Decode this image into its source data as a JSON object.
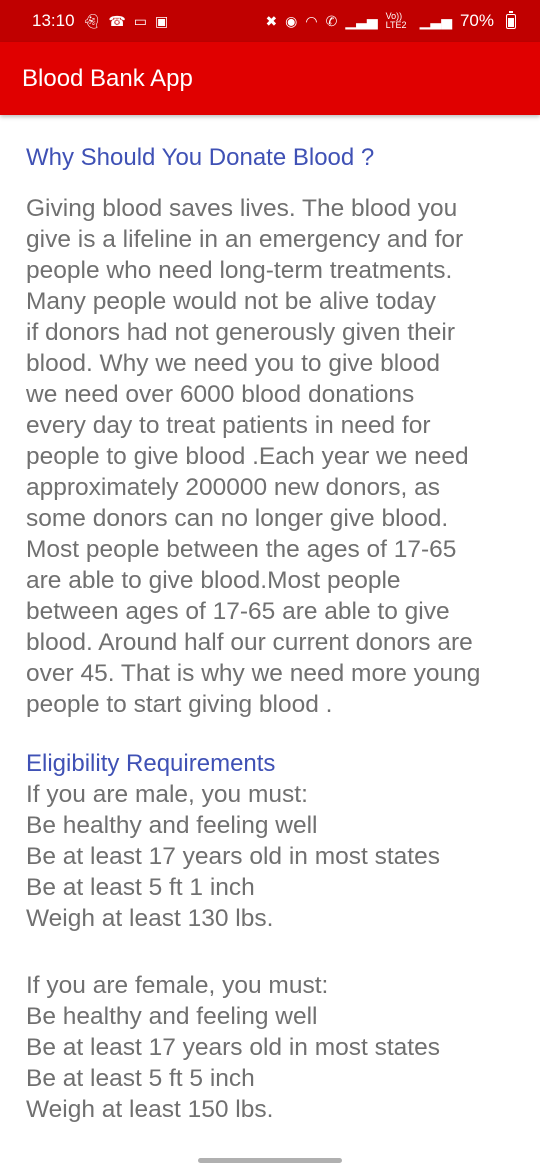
{
  "status_bar": {
    "time": "13:10",
    "left_icons": [
      "snapchat-icon",
      "missed-call-icon",
      "screen-cast-icon",
      "image-icon"
    ],
    "right_icons": [
      "mute-icon",
      "location-icon",
      "wifi-icon",
      "wifi-call-icon",
      "signal-icon",
      "volte-icon",
      "signal-icon"
    ],
    "volte_label": "Vo)) LTE2",
    "battery": "70%"
  },
  "app_bar": {
    "title": "Blood Bank App",
    "color": "#e00000"
  },
  "section1": {
    "heading": "Why Should You Donate Blood ?",
    "body": "Giving blood saves lives. The blood you\ngive is a lifeline in an emergency and for\npeople who need long-term treatments.\nMany people would not be alive today\nif donors had not generously given their\nblood. Why we need you to give blood\nwe need over 6000 blood donations\nevery day to treat patients in need for\npeople to give blood .Each year we need\napproximately 200000 new donors, as\nsome donors can no longer give blood.\nMost people between the ages of 17-65\nare able to give blood.Most people\nbetween ages of 17-65 are able to give\nblood. Around half our current donors are\nover 45. That is why we need more young\npeople to start giving blood ."
  },
  "section2": {
    "heading": "Eligibility Requirements",
    "male": "If you are male, you must:\nBe healthy and feeling well\nBe at least 17 years old in most states\nBe at least 5 ft 1 inch\nWeigh at least 130 lbs.",
    "female": "If you are female, you must:\nBe healthy and feeling well\nBe at least 17 years old in most states\nBe at least 5 ft 5 inch\nWeigh at least 150 lbs."
  },
  "colors": {
    "heading": "#3f51b5",
    "body_text": "#707070",
    "status_bar": "#c00000"
  }
}
